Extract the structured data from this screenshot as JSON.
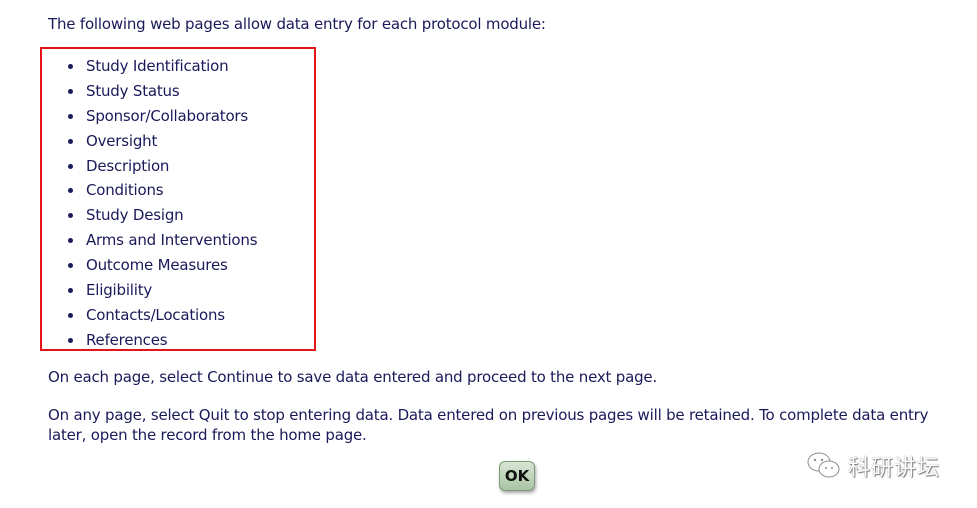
{
  "intro_text": "The following web pages allow data entry for each protocol module:",
  "modules": [
    "Study Identification",
    "Study Status",
    "Sponsor/Collaborators",
    "Oversight",
    "Description",
    "Conditions",
    "Study Design",
    "Arms and Interventions",
    "Outcome Measures",
    "Eligibility",
    "Contacts/Locations",
    "References"
  ],
  "paragraphs": {
    "continue_info": "On each page, select Continue to save data entered and proceed to the next page.",
    "quit_info": "On any page, select Quit to stop entering data. Data entered on previous pages will be retained. To complete data entry later, open the record from the home page."
  },
  "ok_button": {
    "label": "OK"
  },
  "watermark": {
    "icon": "wechat-icon",
    "text": "科研讲坛"
  },
  "colors": {
    "text": "#1a1a5a",
    "highlight_border": "#e3141a",
    "button_green": "#b9cfb5"
  }
}
